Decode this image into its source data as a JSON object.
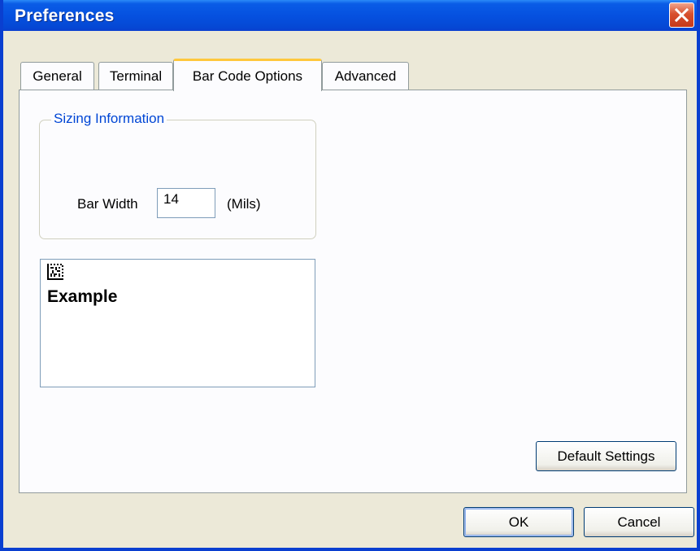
{
  "window": {
    "title": "Preferences"
  },
  "tabs": [
    {
      "label": "General"
    },
    {
      "label": "Terminal"
    },
    {
      "label": "Bar Code Options"
    },
    {
      "label": "Advanced"
    }
  ],
  "active_tab": "Bar Code Options",
  "sizing": {
    "group_label": "Sizing Information",
    "bar_width_label": "Bar Width",
    "bar_width_value": "14",
    "units": "(Mils)"
  },
  "preview": {
    "example_text": "Example"
  },
  "buttons": {
    "default_settings": "Default Settings",
    "ok": "OK",
    "cancel": "Cancel"
  },
  "colors": {
    "titlebar": "#0551e0",
    "group_label": "#0046d5",
    "active_tab_accent": "#ffc83c",
    "dialog_bg": "#ece9d8"
  }
}
